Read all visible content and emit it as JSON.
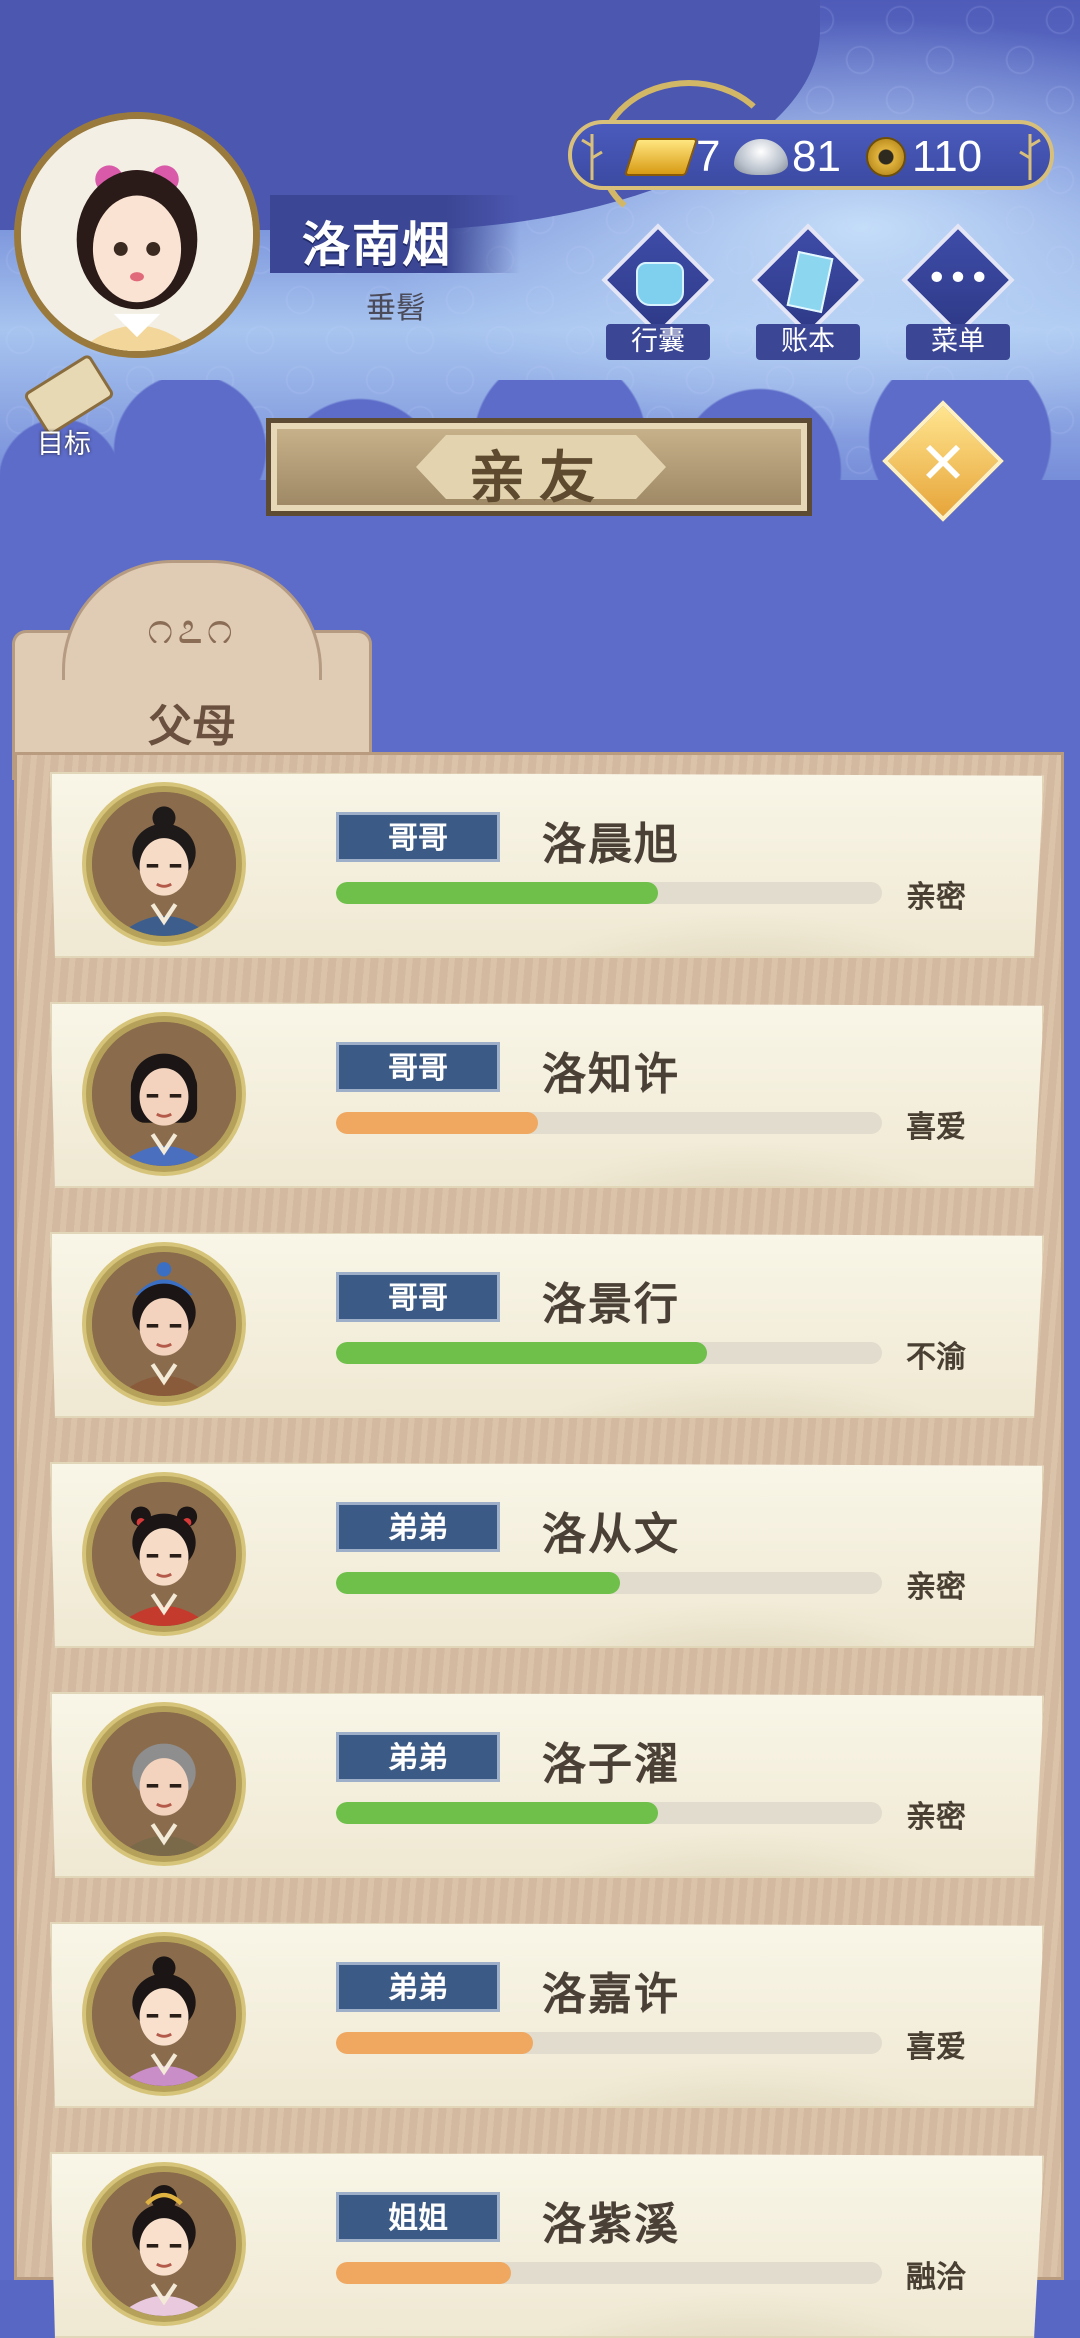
{
  "player": {
    "name": "洛南烟",
    "title": "垂髫"
  },
  "currency": {
    "gold": "7",
    "silver": "81",
    "coins": "110"
  },
  "header_buttons": [
    {
      "label": "行囊",
      "icon": "bag-icon"
    },
    {
      "label": "账本",
      "icon": "ledger-icon"
    },
    {
      "label": "菜单",
      "icon": "menu-dots-icon",
      "glyph": "•••"
    }
  ],
  "goal": {
    "label": "目标"
  },
  "banner": {
    "title": "亲友"
  },
  "close": {
    "glyph": "✕"
  },
  "tab": {
    "label": "父母",
    "ornament": "೧೭೧"
  },
  "colors": {
    "green": "#6ec04a",
    "orange": "#f0a860"
  },
  "members": [
    {
      "relation": "哥哥",
      "name": "洛晨旭",
      "status": "亲密",
      "affinity": 0.59,
      "bar_color": "green",
      "face": "boy-topknot"
    },
    {
      "relation": "哥哥",
      "name": "洛知许",
      "status": "喜爱",
      "affinity": 0.37,
      "bar_color": "orange",
      "face": "boy-long-hair"
    },
    {
      "relation": "哥哥",
      "name": "洛景行",
      "status": "不渝",
      "affinity": 0.68,
      "bar_color": "green",
      "face": "boy-blue-hat"
    },
    {
      "relation": "弟弟",
      "name": "洛从文",
      "status": "亲密",
      "affinity": 0.52,
      "bar_color": "green",
      "face": "boy-red-robe"
    },
    {
      "relation": "弟弟",
      "name": "洛子濯",
      "status": "亲密",
      "affinity": 0.59,
      "bar_color": "green",
      "face": "boy-grey-hair"
    },
    {
      "relation": "弟弟",
      "name": "洛嘉许",
      "status": "喜爱",
      "affinity": 0.36,
      "bar_color": "orange",
      "face": "boy-small-bun"
    },
    {
      "relation": "姐姐",
      "name": "洛紫溪",
      "status": "融洽",
      "affinity": 0.32,
      "bar_color": "orange",
      "face": "girl-hair-ornament"
    }
  ]
}
